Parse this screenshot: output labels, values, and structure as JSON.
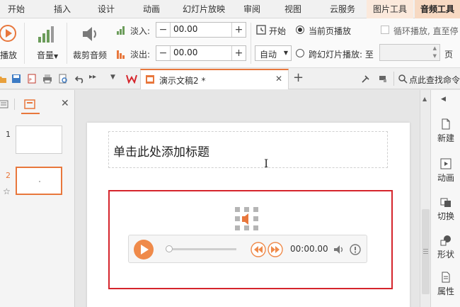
{
  "tabs": [
    "开始",
    "插入",
    "设计",
    "动画",
    "幻灯片放映",
    "审阅",
    "视图",
    "云服务",
    "图片工具",
    "音频工具"
  ],
  "ribbon": {
    "play_label": "播放",
    "volume_label": "音量",
    "trim_label": "裁剪音频",
    "fade_in_label": "淡入:",
    "fade_in_value": "00.00",
    "fade_out_label": "淡出:",
    "fade_out_value": "00.00",
    "start_label": "开始",
    "start_value": "自动",
    "current_page_label": "当前页播放",
    "cross_slide_label": "跨幻灯片播放: 至",
    "loop_label": "循环播放, 直至停",
    "page_suffix": "页"
  },
  "quickbar": {
    "doc_tab_title": "演示文稿2 *",
    "search_label": "点此查找命令"
  },
  "thumbnails": [
    {
      "number": "1"
    },
    {
      "number": "2"
    }
  ],
  "slide": {
    "title_placeholder": "单击此处添加标题",
    "player_time": "00:00.00"
  },
  "rightpane": [
    "新建",
    "动画",
    "切换",
    "形状",
    "属性"
  ],
  "colors": {
    "accent": "#e8773c",
    "selection": "#d5252c"
  }
}
